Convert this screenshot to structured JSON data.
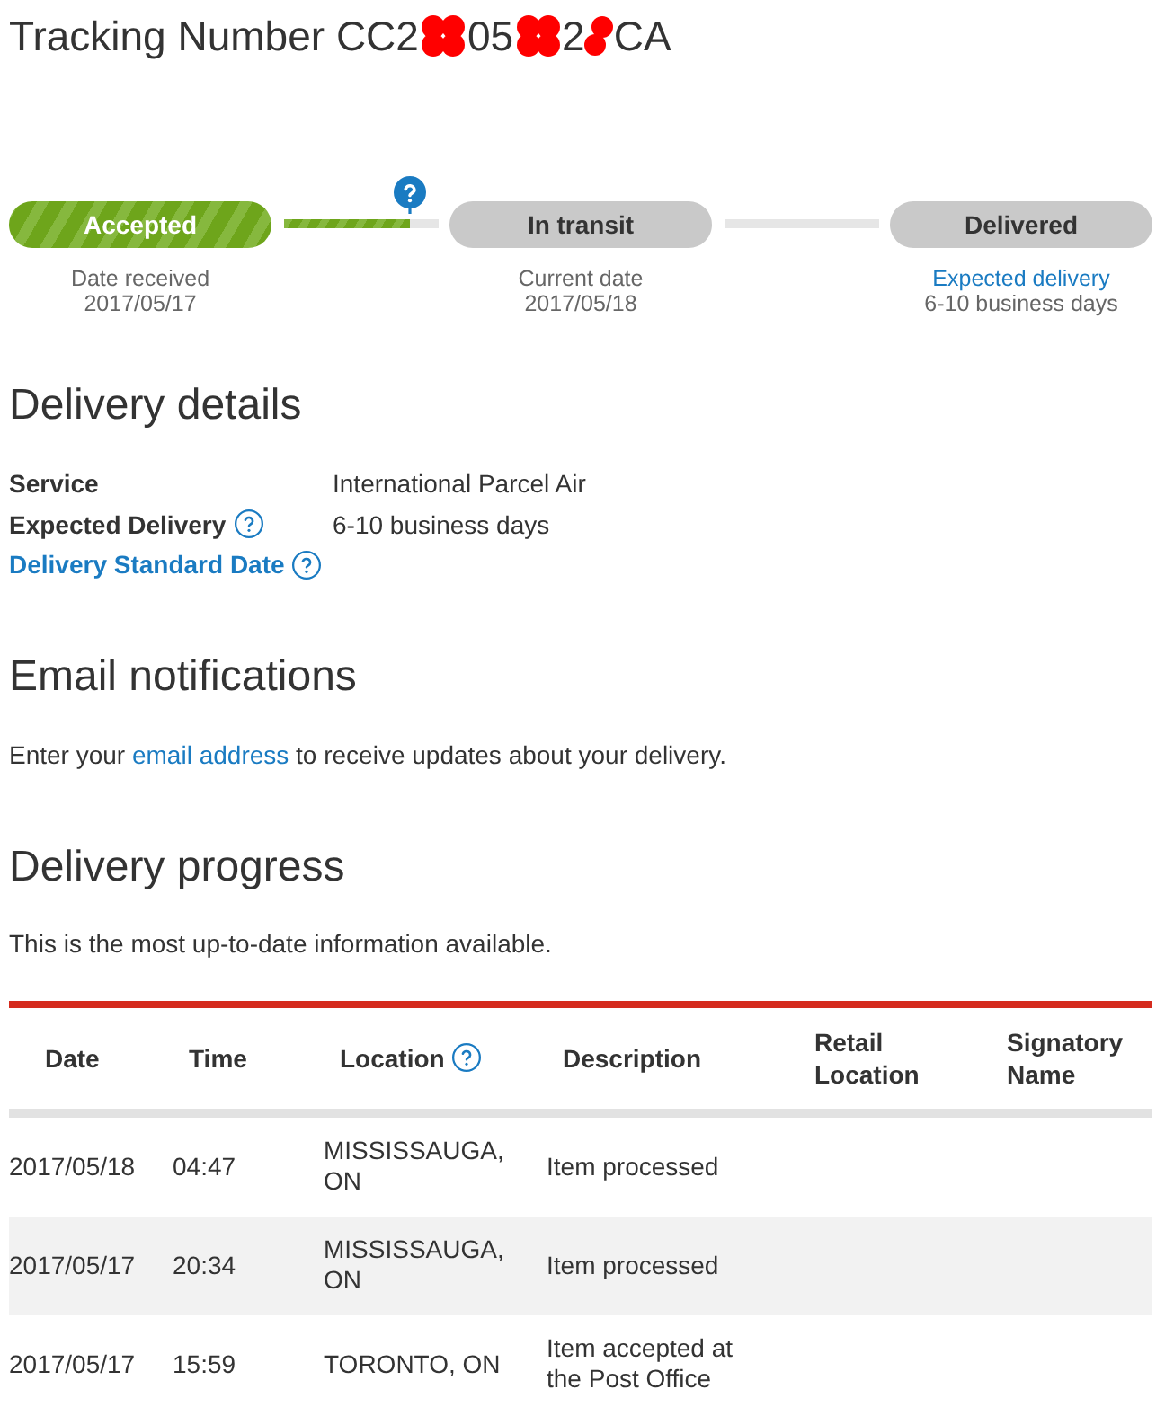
{
  "title": "Tracking Number",
  "tracking_number": [
    {
      "kind": "text",
      "text": "CC2"
    },
    {
      "kind": "redacted"
    },
    {
      "kind": "text",
      "text": "05"
    },
    {
      "kind": "redacted"
    },
    {
      "kind": "text",
      "text": "2"
    },
    {
      "kind": "redacted"
    },
    {
      "kind": "text",
      "text": "CA"
    }
  ],
  "stages": [
    {
      "label": "Accepted",
      "complete": true,
      "caption": "Date received",
      "caption_link": false,
      "detail": "2017/05/17"
    },
    {
      "label": "In transit",
      "complete": false,
      "caption": "Current date",
      "caption_link": false,
      "detail": "2017/05/18"
    },
    {
      "label": "Delivered",
      "complete": false,
      "caption": "Expected delivery",
      "caption_link": true,
      "detail": "6-10 business days"
    }
  ],
  "connectors": [
    {
      "level": 0.81,
      "help_marker": true
    },
    {
      "help_marker": false
    }
  ],
  "delivery_details": {
    "heading": "Delivery details",
    "rows": [
      {
        "label": "Service",
        "link": false,
        "help": false,
        "value": "International Parcel Air"
      },
      {
        "label": "Expected Delivery",
        "link": false,
        "help": true,
        "value": "6-10 business days"
      },
      {
        "label": "Delivery Standard Date",
        "link": true,
        "help": true
      }
    ]
  },
  "email_notifications": {
    "heading": "Email notifications",
    "text_before": "Enter your ",
    "link": "email address",
    "text_after": " to receive updates about your delivery."
  },
  "delivery_progress": {
    "heading": "Delivery progress",
    "note": "This is the most up-to-date information available.",
    "table": {
      "columns": [
        {
          "label": "Date",
          "help": false
        },
        {
          "label": "Time",
          "help": false
        },
        {
          "label": "Location",
          "help": true
        },
        {
          "label": "Description",
          "help": false
        },
        {
          "label": "Retail Location",
          "help": false
        },
        {
          "label": "Signatory Name",
          "help": false
        }
      ],
      "rows": [
        {
          "date": "2017/05/18",
          "time": "04:47",
          "location": "MISSISSAUGA, ON",
          "description": "Item processed"
        },
        {
          "date": "2017/05/17",
          "time": "20:34",
          "location": "MISSISSAUGA, ON",
          "description": "Item processed"
        },
        {
          "date": "2017/05/17",
          "time": "15:59",
          "location": "TORONTO, ON",
          "description": "Item accepted at the Post Office"
        }
      ]
    }
  }
}
